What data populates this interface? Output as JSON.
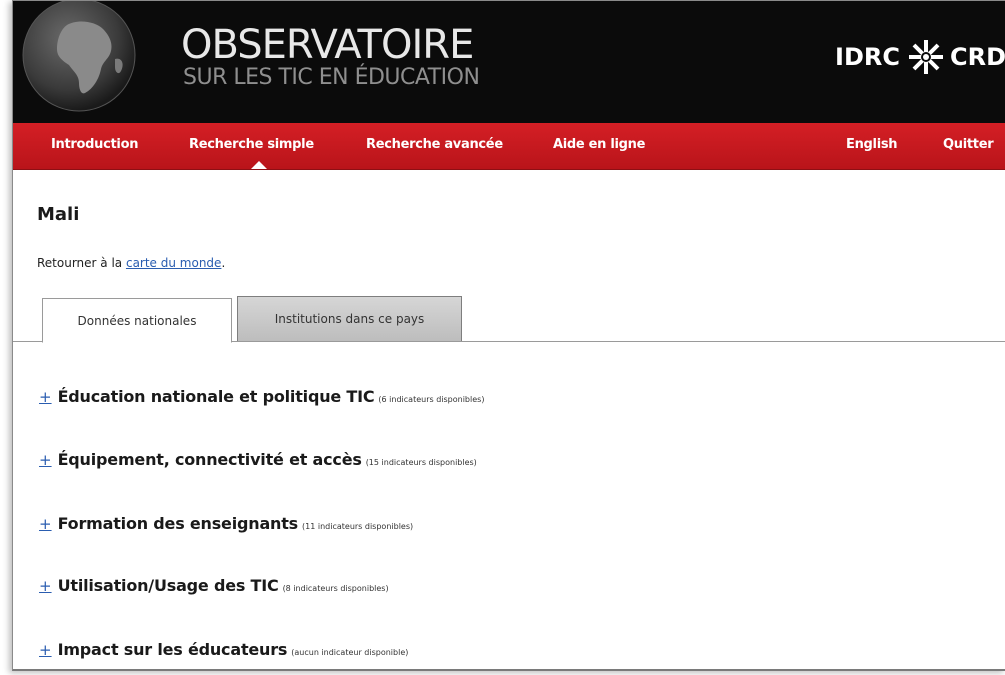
{
  "header": {
    "title": "OBSERVATOIRE",
    "subtitle": "SUR LES TIC EN ÉDUCATION",
    "partner_left": "IDRC",
    "partner_right": "CRD"
  },
  "nav": {
    "items": [
      {
        "label": "Introduction"
      },
      {
        "label": "Recherche simple"
      },
      {
        "label": "Recherche avancée"
      },
      {
        "label": "Aide en ligne"
      }
    ],
    "language": "English",
    "quit": "Quitter"
  },
  "page": {
    "country": "Mali",
    "back_prefix": "Retourner à la ",
    "back_link": "carte du monde",
    "back_suffix": "."
  },
  "tabs": [
    {
      "label": "Données nationales",
      "active": true
    },
    {
      "label": "Institutions dans ce pays",
      "active": false
    }
  ],
  "sections": [
    {
      "toggle": "+",
      "title": "Éducation nationale et politique TIC",
      "count": "(6 indicateurs disponibles)"
    },
    {
      "toggle": "+",
      "title": "Équipement, connectivité et accès",
      "count": "(15 indicateurs disponibles)"
    },
    {
      "toggle": "+",
      "title": "Formation des enseignants",
      "count": "(11 indicateurs disponibles)"
    },
    {
      "toggle": "+",
      "title": "Utilisation/Usage des TIC",
      "count": "(8 indicateurs disponibles)"
    },
    {
      "toggle": "+",
      "title": "Impact sur les éducateurs",
      "count": "(aucun indicateur disponible)"
    }
  ],
  "colors": {
    "nav_red": "#c8171e",
    "banner_black": "#0b0b0b",
    "link_blue": "#2a5db0"
  }
}
